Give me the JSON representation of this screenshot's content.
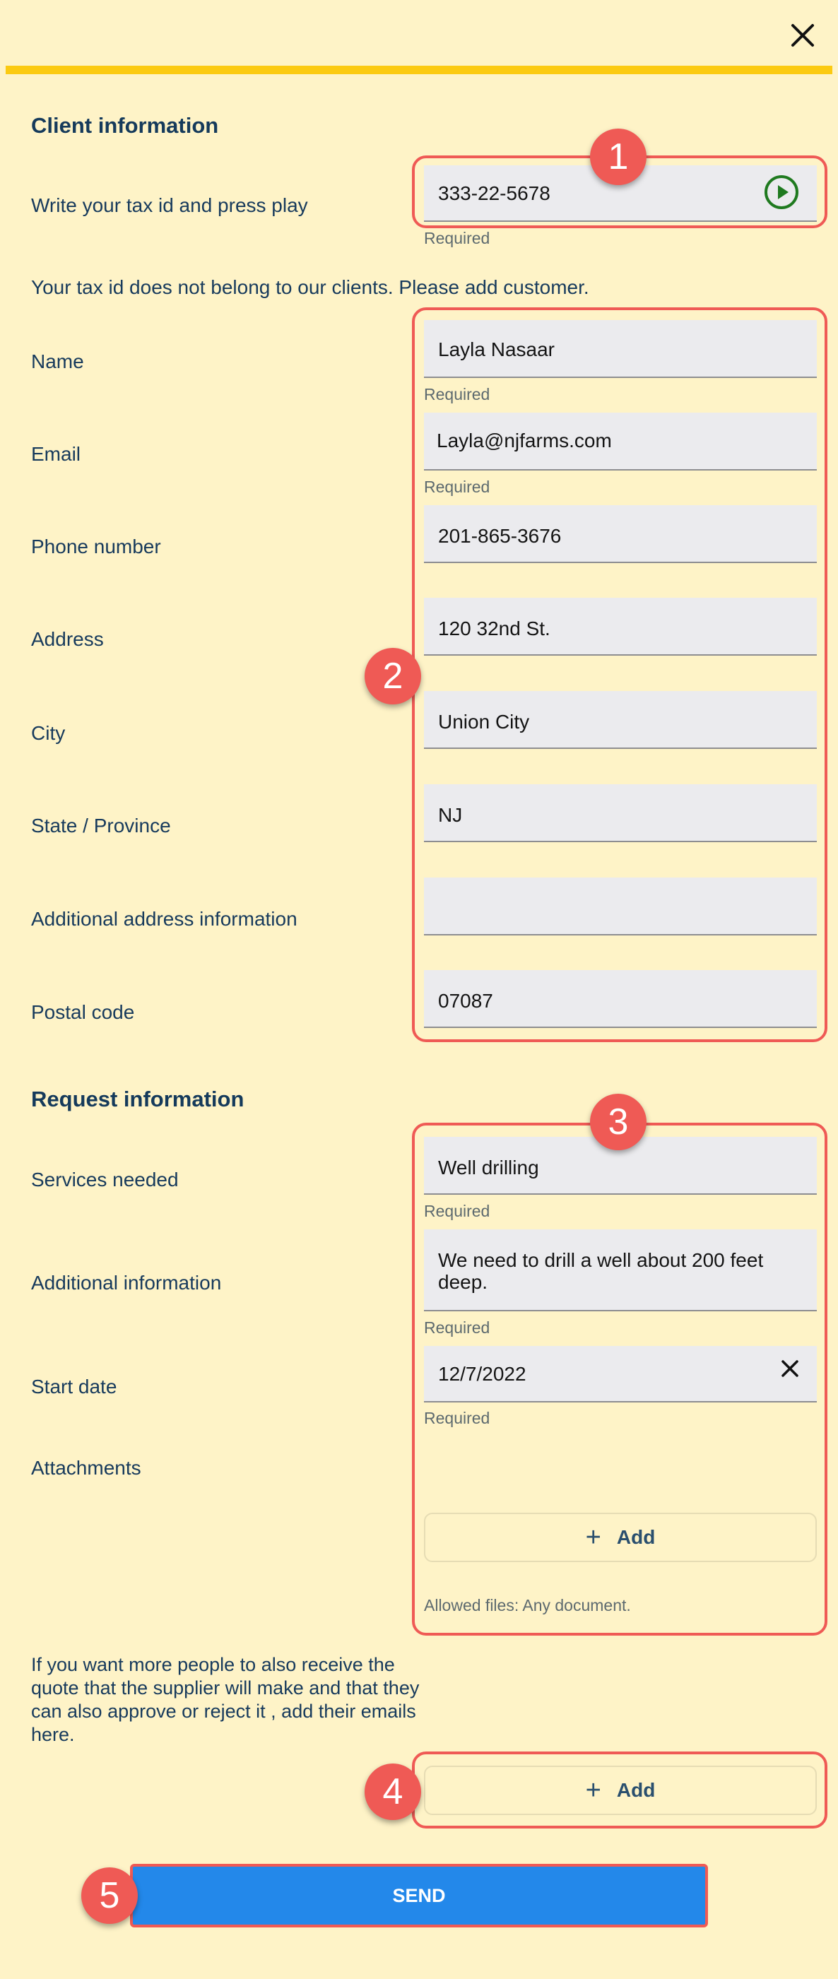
{
  "header": {
    "close_icon": "close-icon"
  },
  "client": {
    "title": "Client information",
    "tax_label": "Write your tax id and press play",
    "tax_value": "333-22-5678",
    "required": "Required",
    "not_found_msg": "Your tax id does not belong to our clients. Please add customer.",
    "fields": {
      "name": {
        "label": "Name",
        "value": "Layla Nasaar"
      },
      "email": {
        "label": "Email",
        "value": "Layla@njfarms.com"
      },
      "phone": {
        "label": "Phone number",
        "value": "201-865-3676"
      },
      "address": {
        "label": "Address",
        "value": "120 32nd St."
      },
      "city": {
        "label": "City",
        "value": "Union City"
      },
      "state": {
        "label": "State / Province",
        "value": "NJ"
      },
      "additional": {
        "label": "Additional address information",
        "value": ""
      },
      "postal": {
        "label": "Postal code",
        "value": "07087"
      }
    }
  },
  "request": {
    "title": "Request information",
    "services": {
      "label": "Services needed",
      "value": "Well drilling"
    },
    "additional": {
      "label": "Additional information",
      "value": "We need to drill a well about 200 feet deep."
    },
    "start_date": {
      "label": "Start date",
      "value": "12/7/2022"
    },
    "attachments": {
      "label": "Attachments",
      "add_label": "Add",
      "allowed": "Allowed files: Any document."
    },
    "required": "Required"
  },
  "recipients": {
    "text": "If you want more people to also receive the quote that the supplier will make and that they can also approve or reject it , add their emails here.",
    "add_label": "Add"
  },
  "send_label": "SEND",
  "badges": [
    "1",
    "2",
    "3",
    "4",
    "5"
  ],
  "colors": {
    "background": "#fef3c7",
    "accent_bar": "#fbca12",
    "highlight": "#ef5a55",
    "send_button": "#2388ea",
    "play_icon": "#1f7a1f"
  }
}
